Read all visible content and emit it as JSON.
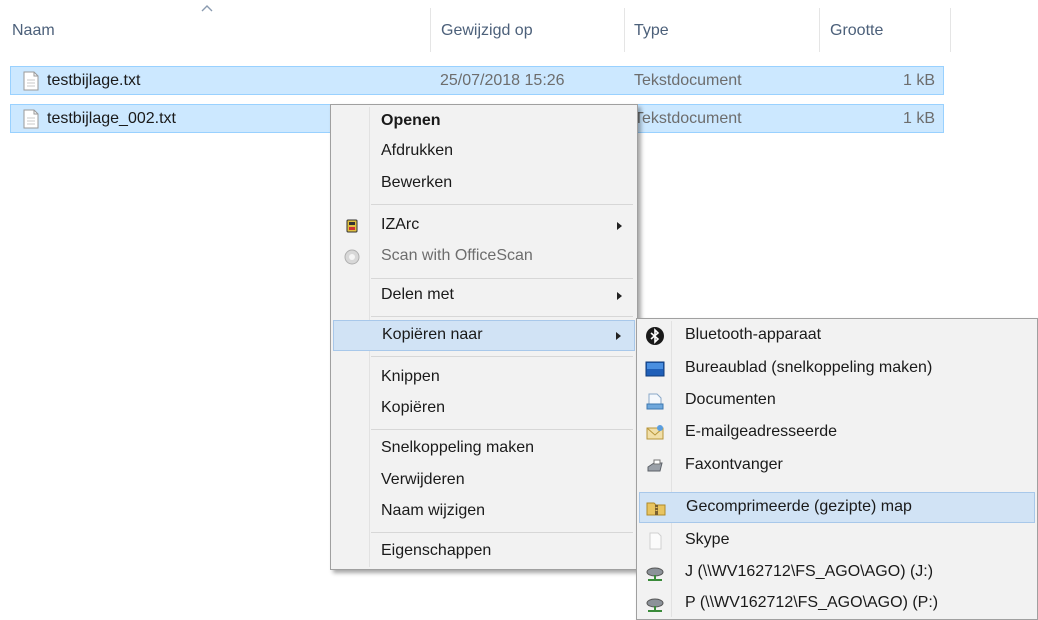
{
  "columns": {
    "name": "Naam",
    "modified": "Gewijzigd op",
    "type": "Type",
    "size": "Grootte"
  },
  "files": [
    {
      "name": "testbijlage.txt",
      "date": "25/07/2018 15:26",
      "type": "Tekstdocument",
      "size": "1 kB"
    },
    {
      "name": "testbijlage_002.txt",
      "date": "",
      "type": "Tekstdocument",
      "size": "1 kB"
    }
  ],
  "context_menu": {
    "open": "Openen",
    "print": "Afdrukken",
    "edit": "Bewerken",
    "izarc": "IZArc",
    "scan": "Scan with OfficeScan",
    "share_with": "Delen met",
    "copy_to": "Kopiëren naar",
    "cut": "Knippen",
    "copy": "Kopiëren",
    "create_shortcut": "Snelkoppeling maken",
    "delete": "Verwijderen",
    "rename": "Naam wijzigen",
    "properties": "Eigenschappen"
  },
  "submenu": {
    "bluetooth": "Bluetooth-apparaat",
    "desktop": "Bureaublad (snelkoppeling maken)",
    "documents": "Documenten",
    "mail": "E-mailgeadresseerde",
    "fax": "Faxontvanger",
    "zip": "Gecomprimeerde (gezipte) map",
    "skype": "Skype",
    "drive_j": "J (\\\\WV162712\\FS_AGO\\AGO) (J:)",
    "drive_p": "P (\\\\WV162712\\FS_AGO\\AGO) (P:)"
  },
  "colors": {
    "selection": "#cce8ff",
    "selection_border": "#99d1ff",
    "menu_bg": "#f2f2f2",
    "menu_hover": "#d1e3f5",
    "header_text": "#4c607a"
  }
}
